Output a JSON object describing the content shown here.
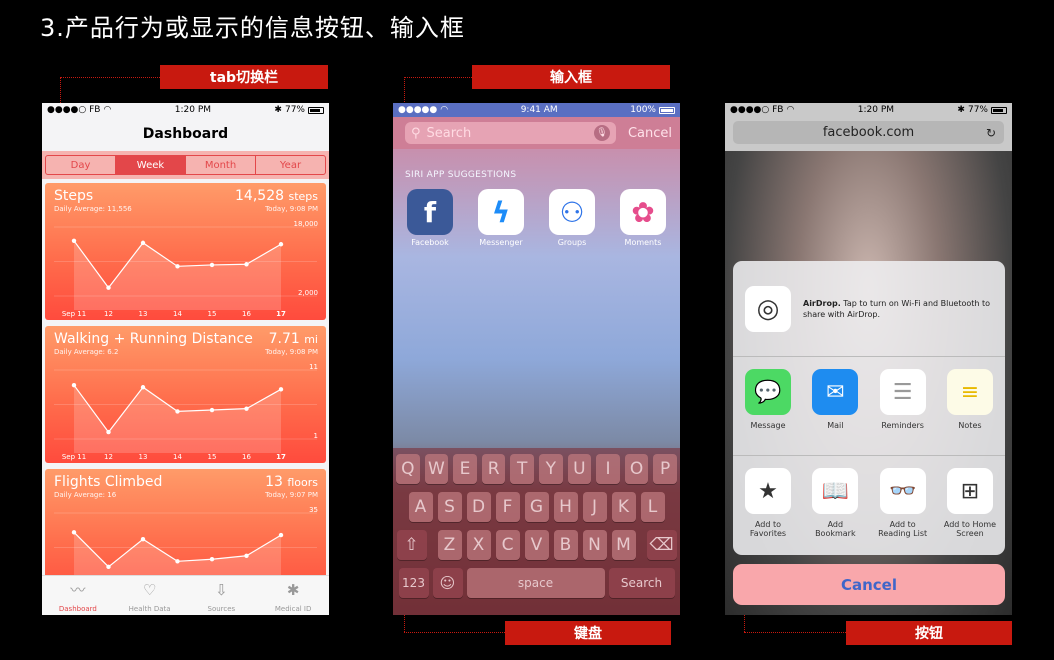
{
  "slide_title": "3.产品行为或显示的信息按钮、输入框",
  "annotations": {
    "tab_switch": "tab切换栏",
    "input_box": "输入框",
    "keyboard": "键盘",
    "button": "按钮"
  },
  "health_app": {
    "status": {
      "carrier": "●●●●○ FB",
      "time": "1:20 PM",
      "battery": "77%"
    },
    "title": "Dashboard",
    "segments": [
      {
        "label": "Day",
        "selected": false
      },
      {
        "label": "Week",
        "selected": true
      },
      {
        "label": "Month",
        "selected": false
      },
      {
        "label": "Year",
        "selected": false
      }
    ],
    "cards": [
      {
        "title": "Steps",
        "value": "14,528",
        "unit": "steps",
        "subtitle": "Daily Average: 11,556",
        "date": "Today, 9:08 PM",
        "ymax": "18,000",
        "ymin": "2,000",
        "x_labels": [
          "Sep 11",
          "12",
          "13",
          "14",
          "15",
          "16",
          "17"
        ],
        "values": [
          0.8,
          0.12,
          0.77,
          0.43,
          0.45,
          0.46,
          0.75
        ]
      },
      {
        "title": "Walking + Running Distance",
        "value": "7.71",
        "unit": "mi",
        "subtitle": "Daily Average: 6.2",
        "date": "Today, 9:08 PM",
        "ymax": "11",
        "ymin": "1",
        "x_labels": [
          "Sep 11",
          "12",
          "13",
          "14",
          "15",
          "16",
          "17"
        ],
        "values": [
          0.78,
          0.1,
          0.75,
          0.4,
          0.42,
          0.44,
          0.72
        ]
      },
      {
        "title": "Flights Climbed",
        "value": "13",
        "unit": "floors",
        "subtitle": "Daily Average: 16",
        "date": "Today, 9:07 PM",
        "ymax": "35",
        "ymin": "",
        "x_labels": [
          "Sep 11",
          "12",
          "13",
          "14",
          "15",
          "16",
          "17"
        ],
        "values": [
          0.72,
          0.22,
          0.62,
          0.3,
          0.33,
          0.38,
          0.68
        ]
      }
    ],
    "tabs": [
      {
        "label": "Dashboard",
        "icon": "chart-icon",
        "glyph": "〰",
        "selected": true
      },
      {
        "label": "Health Data",
        "icon": "heart-folder-icon",
        "glyph": "♡",
        "selected": false
      },
      {
        "label": "Sources",
        "icon": "download-icon",
        "glyph": "⇩",
        "selected": false
      },
      {
        "label": "Medical ID",
        "icon": "medical-star-icon",
        "glyph": "✱",
        "selected": false
      }
    ],
    "accent_color": "#e3474a"
  },
  "search_screen": {
    "status": {
      "carrier": "●●●●●",
      "time": "9:41 AM",
      "battery": "100%"
    },
    "search_placeholder": "Search",
    "cancel_label": "Cancel",
    "section_header": "SIRI APP SUGGESTIONS",
    "apps": [
      {
        "label": "Facebook",
        "icon": "facebook-icon",
        "glyph": "f",
        "bg": "#3b5998",
        "fg": "#ffffff"
      },
      {
        "label": "Messenger",
        "icon": "messenger-icon",
        "glyph": "ϟ",
        "bg": "#ffffff",
        "fg": "#1d8cf8"
      },
      {
        "label": "Groups",
        "icon": "groups-icon",
        "glyph": "⚇",
        "bg": "#ffffff",
        "fg": "#2f74e8"
      },
      {
        "label": "Moments",
        "icon": "moments-icon",
        "glyph": "✿",
        "bg": "#ffffff",
        "fg": "#e64d8c"
      }
    ],
    "keyboard": {
      "row1": [
        "Q",
        "W",
        "E",
        "R",
        "T",
        "Y",
        "U",
        "I",
        "O",
        "P"
      ],
      "row2": [
        "A",
        "S",
        "D",
        "F",
        "G",
        "H",
        "J",
        "K",
        "L"
      ],
      "row3": [
        "Z",
        "X",
        "C",
        "V",
        "B",
        "N",
        "M"
      ],
      "shift": "⇧",
      "backspace": "⌫",
      "numbers": "123",
      "emoji": "☺",
      "space": "space",
      "search": "Search"
    }
  },
  "share_sheet": {
    "status": {
      "carrier": "●●●●○ FB",
      "time": "1:20 PM",
      "battery": "77%"
    },
    "url": "facebook.com",
    "reload_icon": "reload-icon",
    "airdrop_title": "AirDrop.",
    "airdrop_text": "Tap to turn on Wi-Fi and Bluetooth to share with AirDrop.",
    "share_row": [
      {
        "label": "Message",
        "icon": "message-icon",
        "glyph": "💬",
        "bg": "#4cd964",
        "fg": "#ffffff"
      },
      {
        "label": "Mail",
        "icon": "mail-icon",
        "glyph": "✉",
        "bg": "#1e8cf0",
        "fg": "#ffffff"
      },
      {
        "label": "Reminders",
        "icon": "reminders-icon",
        "glyph": "☰",
        "bg": "#ffffff",
        "fg": "#999999"
      },
      {
        "label": "Notes",
        "icon": "notes-icon",
        "glyph": "≡",
        "bg": "#fdfbe7",
        "fg": "#e8b900"
      }
    ],
    "action_row": [
      {
        "label": "Add to Favorites",
        "icon": "star-icon",
        "glyph": "★"
      },
      {
        "label": "Add Bookmark",
        "icon": "book-icon",
        "glyph": "📖"
      },
      {
        "label": "Add to Reading List",
        "icon": "glasses-icon",
        "glyph": "👓"
      },
      {
        "label": "Add to Home Screen",
        "icon": "plus-square-icon",
        "glyph": "⊞"
      }
    ],
    "cancel_label": "Cancel"
  }
}
